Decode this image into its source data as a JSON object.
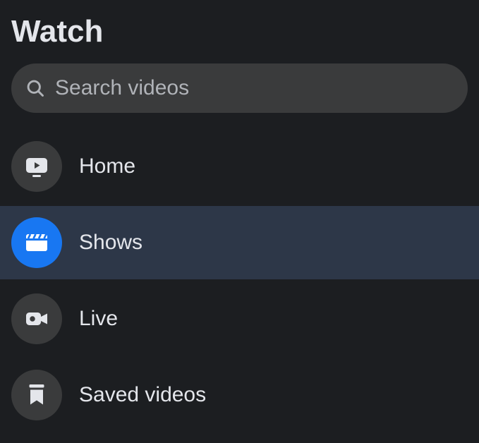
{
  "page_title": "Watch",
  "search": {
    "placeholder": "Search videos"
  },
  "nav": {
    "items": [
      {
        "id": "home",
        "label": "Home",
        "icon": "tv-play-icon",
        "active": false
      },
      {
        "id": "shows",
        "label": "Shows",
        "icon": "clapperboard-icon",
        "active": true
      },
      {
        "id": "live",
        "label": "Live",
        "icon": "video-camera-icon",
        "active": false
      },
      {
        "id": "saved",
        "label": "Saved videos",
        "icon": "bookmark-icon",
        "active": false
      }
    ]
  },
  "colors": {
    "background": "#1c1e21",
    "surface": "#3a3b3c",
    "text_primary": "#e4e6eb",
    "text_secondary": "#b0b3b8",
    "accent": "#1877f2",
    "active_row": "#2d3748"
  }
}
